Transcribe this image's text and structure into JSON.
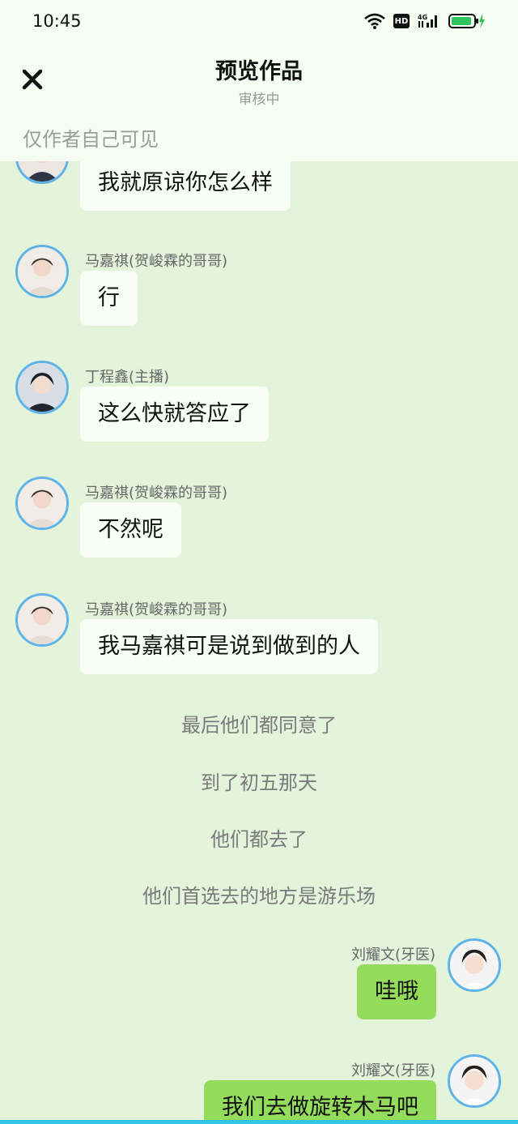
{
  "status_bar": {
    "time": "10:45",
    "hd_label": "HD",
    "network_label": "4G"
  },
  "header": {
    "title": "预览作品",
    "subtitle": "审核中",
    "visibility": "仅作者自己可见"
  },
  "messages": [
    {
      "text": "我就原谅你怎么样"
    },
    {
      "sender": "马嘉祺(贺峻霖的哥哥)",
      "text": "行"
    },
    {
      "sender": "丁程鑫(主播)",
      "text": "这么快就答应了"
    },
    {
      "sender": "马嘉祺(贺峻霖的哥哥)",
      "text": "不然呢"
    },
    {
      "sender": "马嘉祺(贺峻霖的哥哥)",
      "text": "我马嘉祺可是说到做到的人"
    }
  ],
  "narrations": [
    "最后他们都同意了",
    "到了初五那天",
    "他们都去了",
    "他们首选去的地方是游乐场"
  ],
  "my_messages": [
    {
      "sender": "刘耀文(牙医)",
      "text": "哇哦"
    },
    {
      "sender": "刘耀文(牙医)",
      "text": "我们去做旋转木马吧"
    }
  ],
  "colors": {
    "background": "#e3f4db",
    "header_bg": "#f5fcf1",
    "my_bubble": "#93dc5c",
    "other_bubble": "#f8fdf6",
    "avatar_ring": "#5eb3e8"
  }
}
